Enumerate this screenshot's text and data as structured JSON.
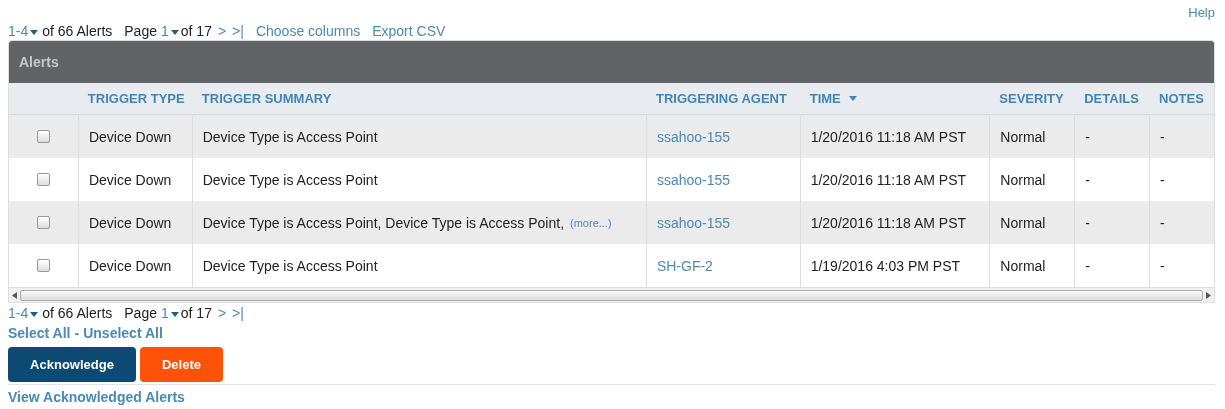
{
  "help": "Help",
  "top_pager": {
    "range": "1-4",
    "of_total": "of 66 Alerts",
    "page_label": "Page",
    "page": "1",
    "of_pages": "of 17",
    "next": ">",
    "last": ">|"
  },
  "toolbar_links": [
    "Choose columns",
    "Export CSV"
  ],
  "table": {
    "title": "Alerts",
    "columns": [
      {
        "label": "TRIGGER TYPE",
        "sorted": false
      },
      {
        "label": "TRIGGER SUMMARY",
        "sorted": false
      },
      {
        "label": "TRIGGERING AGENT",
        "sorted": false
      },
      {
        "label": "TIME",
        "sorted": true
      },
      {
        "label": "SEVERITY",
        "sorted": false
      },
      {
        "label": "DETAILS",
        "sorted": false
      },
      {
        "label": "NOTES",
        "sorted": false
      }
    ],
    "rows": [
      {
        "checked": false,
        "trigger_type": "Device Down",
        "summary": "Device Type is Access Point",
        "agent": "ssahoo-155",
        "time": "1/20/2016 11:18 AM PST",
        "severity": "Normal",
        "details": "-",
        "notes": "-"
      },
      {
        "checked": false,
        "trigger_type": "Device Down",
        "summary": "Device Type is Access Point",
        "agent": "ssahoo-155",
        "time": "1/20/2016 11:18 AM PST",
        "severity": "Normal",
        "details": "-",
        "notes": "-"
      },
      {
        "checked": false,
        "trigger_type": "Device Down",
        "summary": "Device Type is Access Point, Device Type is Access Point,",
        "more": "(more...)",
        "agent": "ssahoo-155",
        "time": "1/20/2016 11:18 AM PST",
        "severity": "Normal",
        "details": "-",
        "notes": "-"
      },
      {
        "checked": false,
        "trigger_type": "Device Down",
        "summary": "Device Type is Access Point",
        "agent": "SH-GF-2",
        "time": "1/19/2016 4:03 PM PST",
        "severity": "Normal",
        "details": "-",
        "notes": "-"
      }
    ]
  },
  "bottom_pager": {
    "range": "1-4",
    "of_total": "of 66 Alerts",
    "page_label": "Page",
    "page": "1",
    "of_pages": "of 17",
    "next": ">",
    "last": ">|"
  },
  "select_all": "Select All",
  "separator": "-",
  "unselect_all": "Unselect All",
  "buttons": [
    {
      "label": "Acknowledge",
      "kind": "primary"
    },
    {
      "label": "Delete",
      "kind": "danger"
    }
  ],
  "view_link": "View Acknowledged Alerts"
}
